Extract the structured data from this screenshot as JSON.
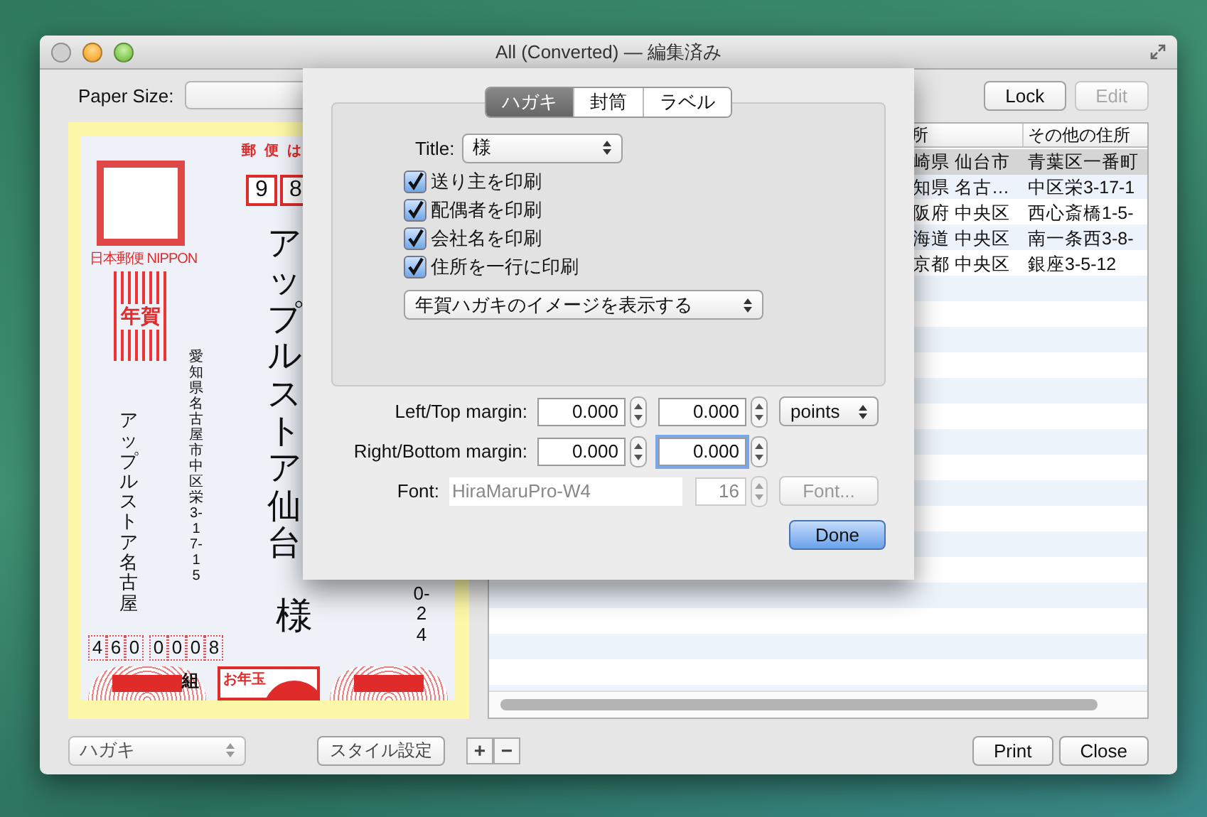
{
  "window": {
    "title": "All (Converted) — 編集済み"
  },
  "toolbar": {
    "paper_size_label": "Paper Size:",
    "buttons": [
      {
        "label": "Lock",
        "disabled": false
      },
      {
        "label": "Edit",
        "disabled": true
      }
    ]
  },
  "postcard": {
    "header": "郵便は",
    "zip_digits": [
      "9",
      "8"
    ],
    "stamp_caption": "日本郵便 NIPPON",
    "nenga_mark": "年賀",
    "recipient_name": "アップルストア仙台",
    "recipient_title": "様",
    "recipient_address": "0-24",
    "sender_address": "愛知県名古屋市中区栄3-17-15",
    "sender_name": "アップルストア名古屋",
    "sender_zip": [
      "4",
      "6",
      "0",
      "0",
      "0",
      "0",
      "8"
    ],
    "group_label": "組",
    "lottery_label": "お年玉"
  },
  "table": {
    "columns": [
      "所",
      "その他の住所"
    ],
    "rows": [
      {
        "cells": [
          "崎県 仙台市",
          "青葉区一番町"
        ],
        "selected": true
      },
      {
        "cells": [
          "知県 名古…",
          "中区栄3-17-1"
        ],
        "selected": false
      },
      {
        "cells": [
          "阪府 中央区",
          "西心斎橋1-5-"
        ],
        "selected": false
      },
      {
        "cells": [
          "海道 中央区",
          "南一条西3-8-"
        ],
        "selected": false
      },
      {
        "cells": [
          "京都 中央区",
          "銀座3-5-12"
        ],
        "selected": false
      }
    ]
  },
  "sheet": {
    "tabs": [
      {
        "label": "ハガキ",
        "selected": true
      },
      {
        "label": "封筒",
        "selected": false
      },
      {
        "label": "ラベル",
        "selected": false
      }
    ],
    "title_label": "Title:",
    "title_value": "様",
    "options": [
      {
        "label": "送り主を印刷",
        "checked": true
      },
      {
        "label": "配偶者を印刷",
        "checked": true
      },
      {
        "label": "会社名を印刷",
        "checked": true
      },
      {
        "label": "住所を一行に印刷",
        "checked": true
      }
    ],
    "image_popup": "年賀ハガキのイメージを表示する",
    "margins": [
      {
        "label": "Left/Top margin:",
        "values": [
          {
            "value": "0.000",
            "focused": false
          },
          {
            "value": "0.000",
            "focused": false
          }
        ]
      },
      {
        "label": "Right/Bottom margin:",
        "values": [
          {
            "value": "0.000",
            "focused": false
          },
          {
            "value": "0.000",
            "focused": true
          }
        ]
      }
    ],
    "unit": "points",
    "font_label": "Font:",
    "font_name": "HiraMaruPro-W4",
    "font_size": "16",
    "font_button": "Font...",
    "font_disabled": true,
    "done": "Done"
  },
  "bottom_bar": {
    "paper_popup": "ハガキ",
    "style_button": "スタイル設定",
    "add": "+",
    "remove": "−",
    "buttons": [
      "Print",
      "Close"
    ]
  }
}
